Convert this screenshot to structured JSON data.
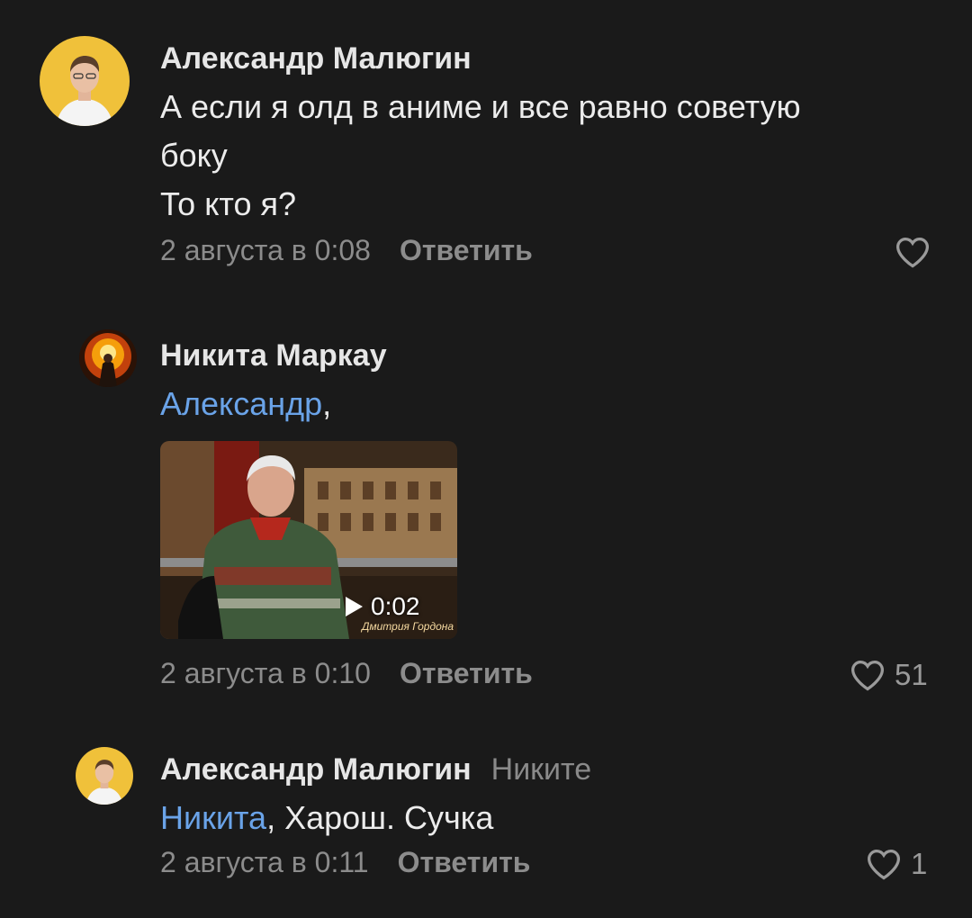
{
  "comments": [
    {
      "author": "Александр Малюгин",
      "lines": [
        "А если я олд в аниме и все равно советую",
        "боку",
        "То кто я?"
      ],
      "date": "2 августа в 0:08",
      "reply_label": "Ответить",
      "likes": ""
    },
    {
      "author": "Никита Маркау",
      "mention": "Александр",
      "mention_suffix": ",",
      "video_duration": "0:02",
      "video_caption": "Дмитрия Гордона",
      "date": "2 августа в 0:10",
      "reply_label": "Ответить",
      "likes": "51"
    },
    {
      "author": "Александр Малюгин",
      "reply_to": "Никите",
      "mention": "Никита",
      "text_after_mention": ", Харош. Сучка",
      "date": "2 августа в 0:11",
      "reply_label": "Ответить",
      "likes": "1"
    }
  ],
  "colors": {
    "background": "#1a1a1a",
    "mention": "#6aa3e8",
    "meta": "#8c8c8c",
    "avatar_bg": "#f0c13a"
  },
  "icons": {
    "like": "heart-outline-icon",
    "play": "play-icon"
  }
}
